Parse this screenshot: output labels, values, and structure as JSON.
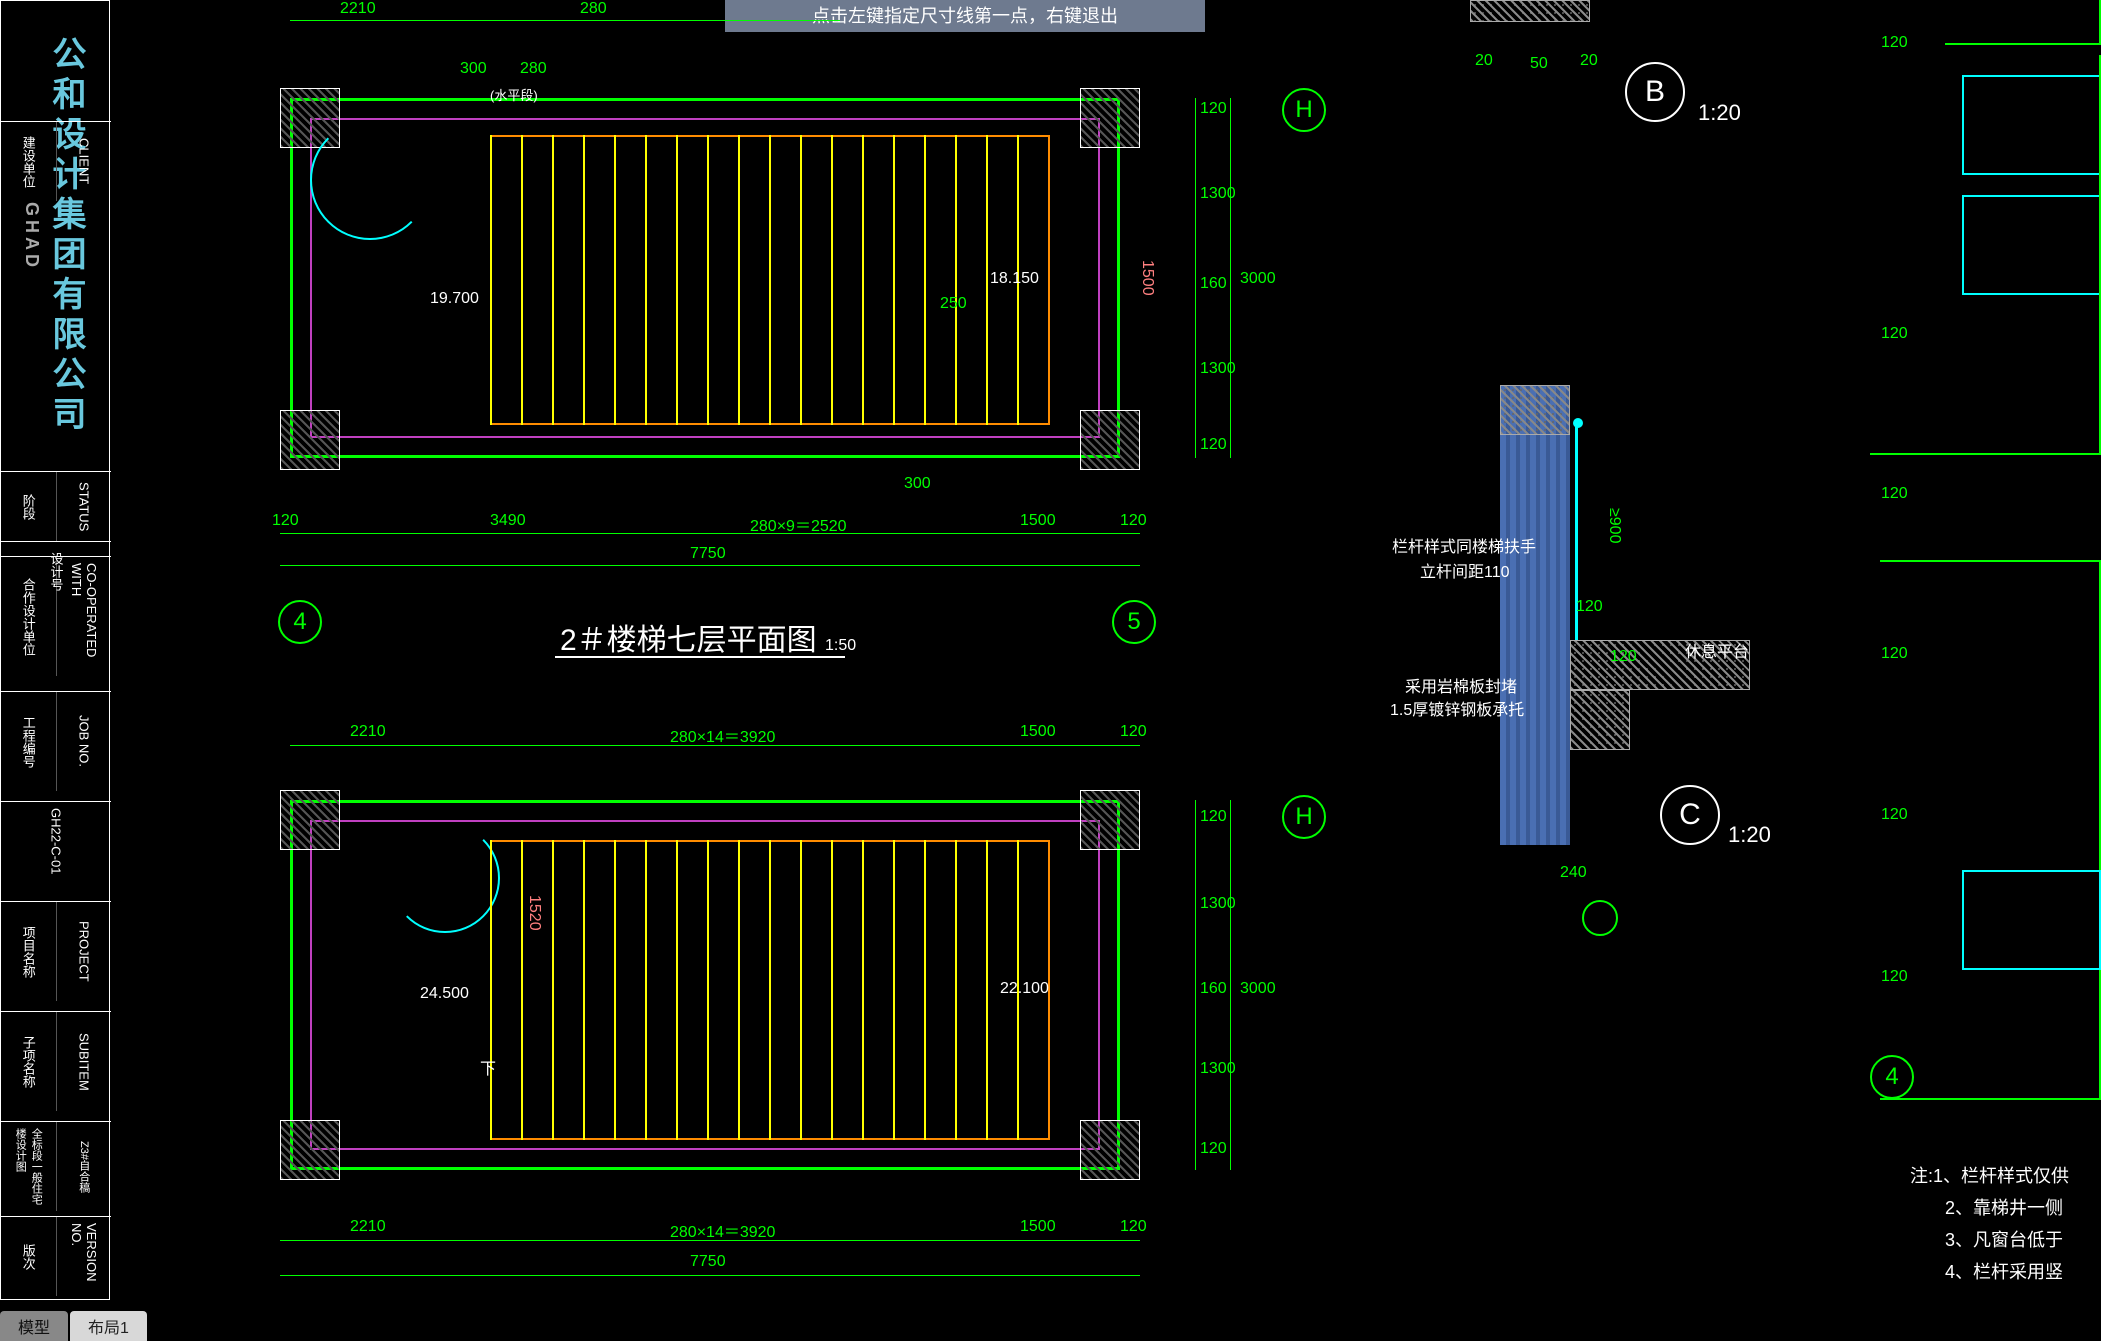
{
  "prompt": "点击左键指定尺寸线第一点，右键退出",
  "tabs": {
    "model": "模型",
    "layout1": "布局1"
  },
  "title_block": {
    "logo_brand": "GHAD",
    "logo_main": "公和设计集团有限公司",
    "rows": [
      {
        "l": "建设单位",
        "r": "CLIENT"
      },
      {
        "l": "阶段",
        "r": "STATUS"
      },
      {
        "l": "合作设计单位",
        "r": "CO-OPERATED WITH"
      },
      {
        "l": "设计号",
        "r": ""
      },
      {
        "l": "工程编号",
        "r": "JOB NO."
      },
      {
        "l": "GH22-C-01",
        "r": ""
      },
      {
        "l": "项目名称",
        "r": "PROJECT"
      },
      {
        "l": "子项名称",
        "r": "SUBITEM"
      },
      {
        "l": "全标段一般住宅楼设计图",
        "r": ""
      },
      {
        "l": "Z3#自合稿",
        "r": ""
      },
      {
        "l": "版次",
        "r": "VERSION NO."
      }
    ]
  },
  "views": {
    "plan1": {
      "title": "2＃楼梯七层平面图",
      "scale": "1:50",
      "dims_top": [
        "2210",
        "280",
        "300",
        "280"
      ],
      "dims_top2": [
        "(水平段)"
      ],
      "dims_bot_row1": [
        "120",
        "3490",
        "280×9＝2520",
        "1500",
        "120"
      ],
      "dims_bot_row2": [
        "7750"
      ],
      "dims_right": [
        "120",
        "1300",
        "160",
        "1300",
        "120"
      ],
      "dims_right_total": "3000",
      "dim_red": "1500",
      "elev": "19.700",
      "landing": "18.150",
      "inner_dim": "250",
      "grids": {
        "h": "H",
        "four": "4",
        "five": "5"
      }
    },
    "plan2": {
      "dims_top": [
        "2210",
        "280×14＝3920",
        "1500",
        "120"
      ],
      "dims_bot_row1": [
        "2210",
        "280×14＝3920",
        "1500",
        "120"
      ],
      "dims_bot_row2": [
        "7750"
      ],
      "dims_right": [
        "120",
        "1300",
        "160",
        "1300",
        "120"
      ],
      "dims_right_total": "3000",
      "dim_red": "1520",
      "elev_left": "24.500",
      "elev_right": "22.100",
      "down": "下",
      "grids": {
        "h": "H"
      }
    },
    "detail_b": {
      "label": "B",
      "scale": "1:20",
      "dims": [
        "20",
        "50",
        "20"
      ]
    },
    "detail_c": {
      "label": "C",
      "scale": "1:20",
      "annot1": "栏杆样式同楼梯扶手",
      "annot2": "立杆间距110",
      "annot3": "采用岩棉板封堵",
      "annot4": "1.5厚镀锌钢板承托",
      "annot5": "休息平台",
      "dims_v": [
        "≥900",
        "120"
      ],
      "dims_h": [
        "120",
        "240"
      ]
    },
    "section_right": {
      "dims_repeat": "120",
      "grid": "4"
    }
  },
  "notes": {
    "prefix": "注:",
    "items": [
      "1、栏杆样式仅供",
      "2、靠梯井一侧",
      "3、凡窗台低于",
      "4、栏杆采用竖"
    ]
  }
}
